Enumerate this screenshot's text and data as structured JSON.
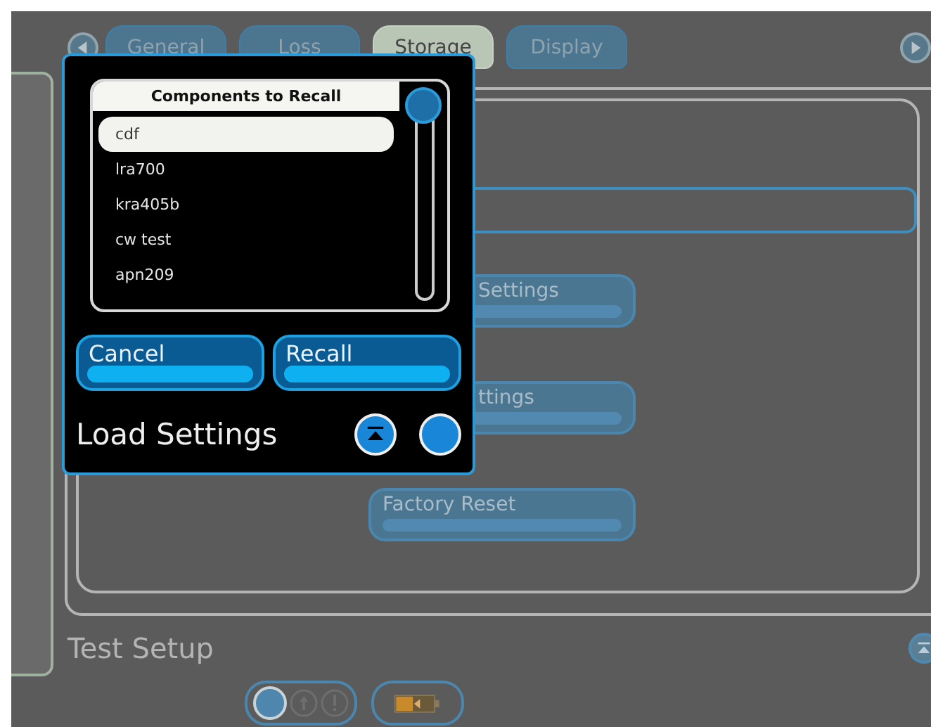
{
  "tabs": [
    {
      "label": "General",
      "selected": false
    },
    {
      "label": "Loss",
      "selected": false
    },
    {
      "label": "Storage",
      "selected": true
    },
    {
      "label": "Display",
      "selected": false
    }
  ],
  "storage_buttons": [
    {
      "label": "Settings",
      "covered": true
    },
    {
      "label": "ttings",
      "covered": true
    },
    {
      "label": "Factory Reset",
      "covered": false
    }
  ],
  "section_title": "Test Setup",
  "dialog": {
    "list_header": "Components to Recall",
    "items": [
      {
        "label": "cdf",
        "selected": true
      },
      {
        "label": "lra700",
        "selected": false
      },
      {
        "label": "kra405b",
        "selected": false
      },
      {
        "label": "cw test",
        "selected": false
      },
      {
        "label": "apn209",
        "selected": false
      }
    ],
    "buttons": [
      "Cancel",
      "Recall"
    ],
    "title": "Load Settings"
  }
}
